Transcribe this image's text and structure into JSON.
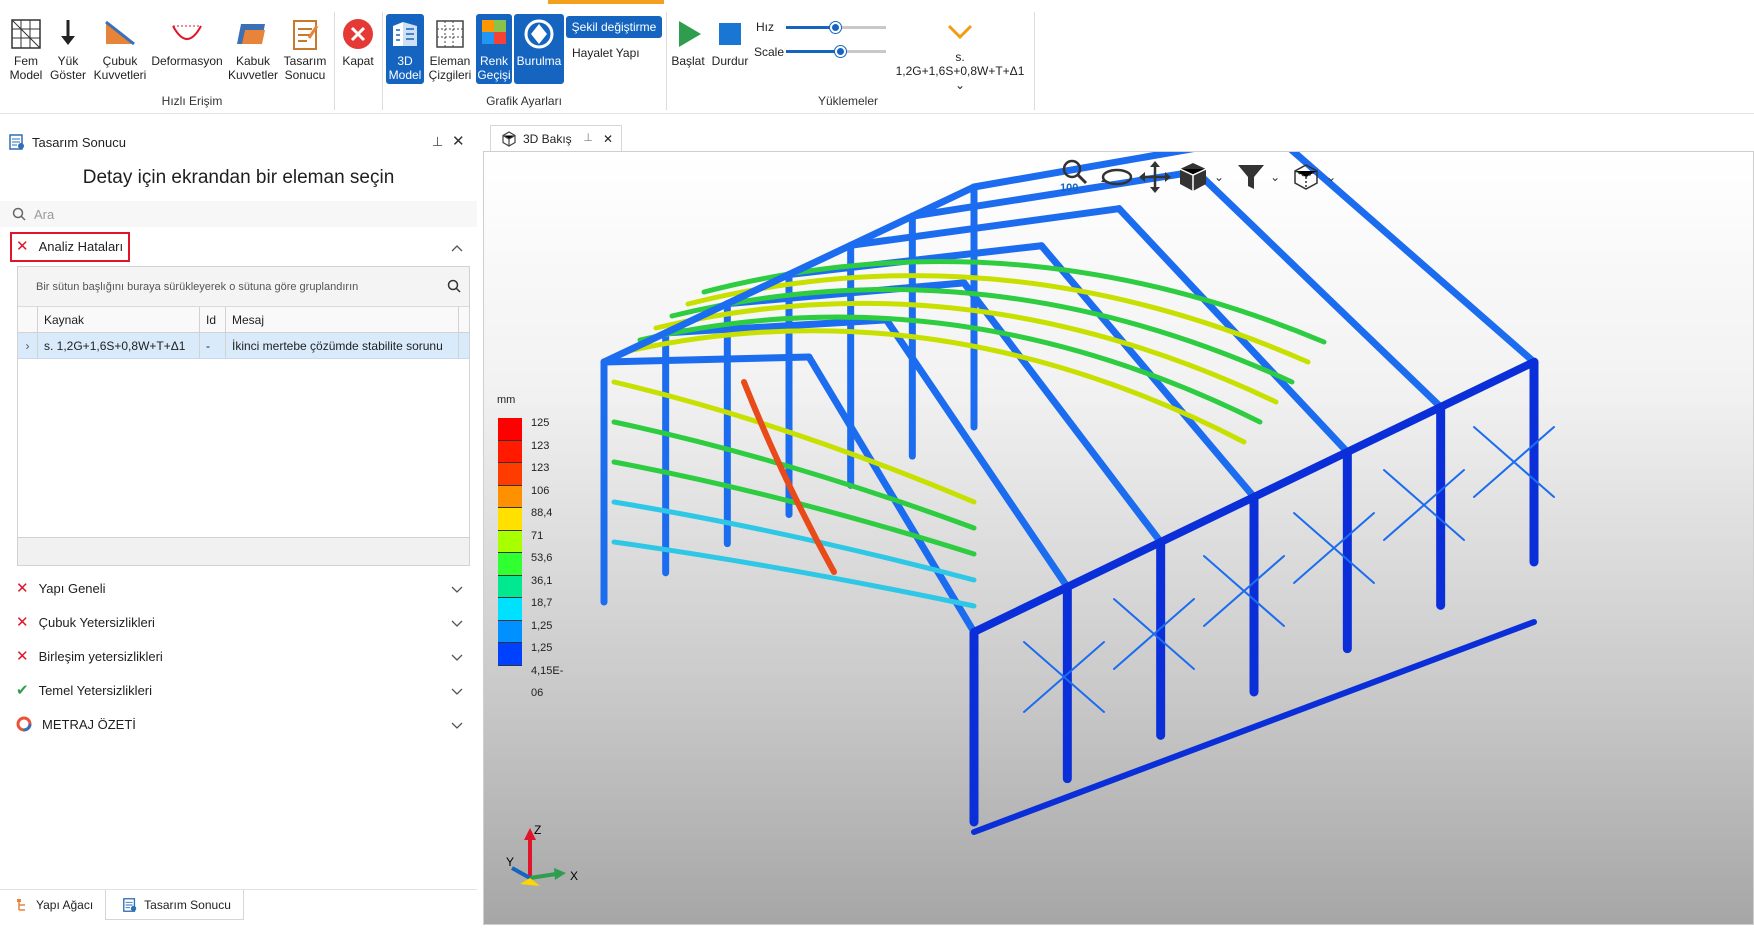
{
  "ribbon": {
    "quick_access": {
      "group_label": "Hızlı Erişim",
      "buttons": [
        {
          "label": "Fem\nModel",
          "icon": "fem-model-icon"
        },
        {
          "label": "Yük\nGöster",
          "icon": "load-arrow-icon"
        },
        {
          "label": "Çubuk\nKuvvetleri",
          "icon": "member-forces-icon"
        },
        {
          "label": "Deformasyon",
          "icon": "deformation-icon"
        },
        {
          "label": "Kabuk\nKuvvetler",
          "icon": "shell-forces-icon"
        },
        {
          "label": "Tasarım\nSonucu",
          "icon": "design-result-icon"
        },
        {
          "label": "Kapat",
          "icon": "close-circle-icon"
        }
      ]
    },
    "graphics": {
      "group_label": "Grafik Ayarları",
      "buttons": [
        {
          "label": "3D\nModel",
          "icon": "3d-model-icon",
          "active": true
        },
        {
          "label": "Eleman\nÇizgileri",
          "icon": "element-lines-icon",
          "active": false
        },
        {
          "label": "Renk\nGeçişi",
          "icon": "color-gradient-icon",
          "active": true
        },
        {
          "label": "Burulma",
          "icon": "torsion-icon",
          "active": true
        }
      ],
      "shape_change": "Şekil değiştirme",
      "ghost": "Hayalet Yapı"
    },
    "loads": {
      "group_label": "Yüklemeler",
      "start": "Başlat",
      "stop": "Durdur",
      "speed_label": "Hız",
      "speed_value": 0.5,
      "scale_label": "Scale",
      "scale_value": 0.55,
      "combo_line1": "s.",
      "combo_line2": "1,2G+1,6S+0,8W+T+Δ1"
    }
  },
  "left_panel": {
    "title": "Tasarım Sonucu",
    "heading": "Detay için ekrandan bir eleman seçin",
    "search_placeholder": "Ara",
    "errors_section": "Analiz Hataları",
    "grid": {
      "group_hint": "Bir sütun başlığını buraya sürükleyerek o sütuna göre gruplandırın",
      "columns": [
        "Kaynak",
        "Id",
        "Mesaj"
      ],
      "rows": [
        {
          "source": "s. 1,2G+1,6S+0,8W+T+Δ1",
          "id": "-",
          "message": "İkinci mertebe çözümde stabilite sorunu"
        }
      ]
    },
    "sections": [
      {
        "label": "Yapı Geneli",
        "status": "error"
      },
      {
        "label": "Çubuk Yetersizlikleri",
        "status": "error"
      },
      {
        "label": "Birleşim yetersizlikleri",
        "status": "error"
      },
      {
        "label": "Temel Yetersizlikleri",
        "status": "ok"
      },
      {
        "label": "METRAJ ÖZETİ",
        "status": "summary"
      }
    ],
    "bottom_tabs": [
      {
        "label": "Yapı Ağacı",
        "active": false
      },
      {
        "label": "Tasarım Sonucu",
        "active": true
      }
    ]
  },
  "viewport": {
    "tab_label": "3D Bakış",
    "zoom": "100",
    "legend": {
      "unit": "mm",
      "values": [
        "125",
        "123",
        "123",
        "106",
        "88,4",
        "71",
        "53,6",
        "36,1",
        "18,7",
        "1,25",
        "1,25",
        "4,15E-06"
      ],
      "colors": [
        "#ff0000",
        "#ff1a00",
        "#ff3c00",
        "#ff9000",
        "#ffe000",
        "#a8ff00",
        "#30ff30",
        "#00e890",
        "#00e0ff",
        "#0090ff",
        "#0040ff",
        "#0010ff"
      ]
    },
    "axes": {
      "x": "X",
      "y": "Y",
      "z": "Z"
    }
  }
}
